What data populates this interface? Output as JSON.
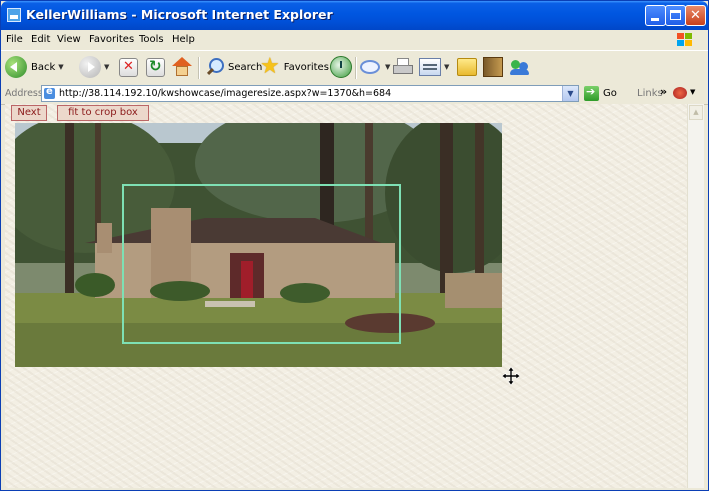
{
  "window": {
    "title": "KellerWilliams - Microsoft Internet Explorer"
  },
  "menu": {
    "items": [
      "File",
      "Edit",
      "View",
      "Favorites",
      "Tools",
      "Help"
    ]
  },
  "toolbar": {
    "back_label": "Back",
    "search_label": "Search",
    "favorites_label": "Favorites"
  },
  "address": {
    "label": "Address",
    "url": "http://38.114.192.10/kwshowcase/imageresize.aspx?w=1370&h=684",
    "go_label": "Go",
    "links_label": "Links"
  },
  "page": {
    "next_label": "Next",
    "fit_label": "fit to crop box"
  }
}
